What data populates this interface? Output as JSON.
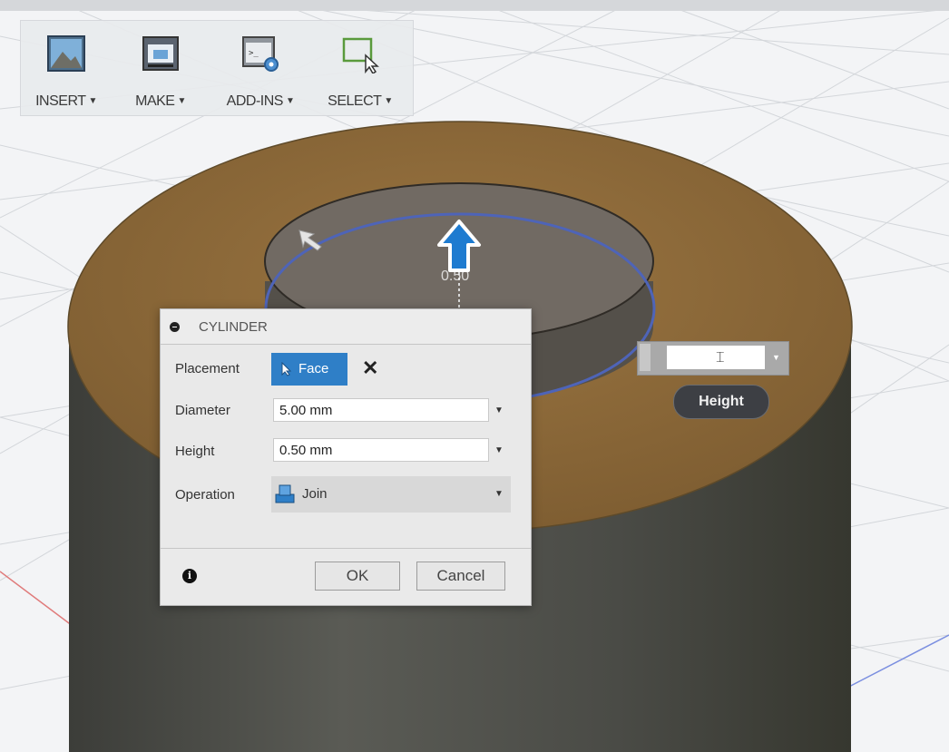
{
  "toolbar": {
    "items": [
      {
        "label": "INSERT",
        "icon": "insert-image-icon"
      },
      {
        "label": "MAKE",
        "icon": "make-3d-print-icon"
      },
      {
        "label": "ADD-INS",
        "icon": "add-ins-icon"
      },
      {
        "label": "SELECT",
        "icon": "select-window-icon"
      }
    ]
  },
  "dialog": {
    "title": "CYLINDER",
    "placement_label": "Placement",
    "placement_value": "Face",
    "diameter_label": "Diameter",
    "diameter_value": "5.00 mm",
    "height_label": "Height",
    "height_value": "0.50 mm",
    "operation_label": "Operation",
    "operation_value": "Join",
    "ok_label": "OK",
    "cancel_label": "Cancel"
  },
  "canvas": {
    "dimension_value": "0.50",
    "height_tooltip": "Height"
  },
  "colors": {
    "top_face": "#8a6738",
    "cylinder_body": "#4e4f4a",
    "accent_blue": "#2f7fc7",
    "grid_bg": "#f3f4f6"
  }
}
